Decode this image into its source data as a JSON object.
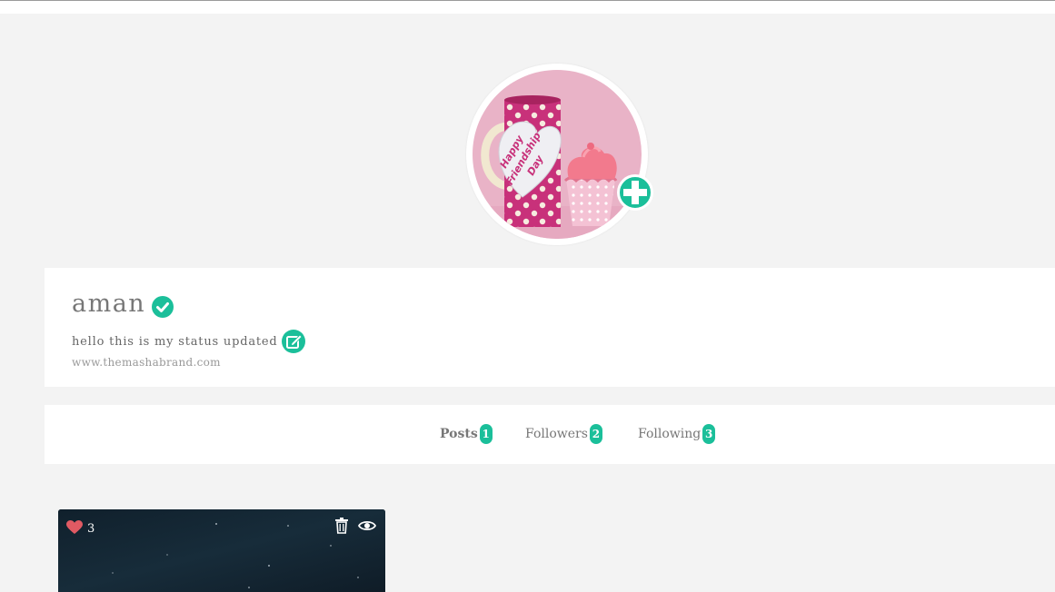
{
  "profile": {
    "username": "aman",
    "status": "hello this is my status updated",
    "website": "www.themashabrand.com",
    "avatar": {
      "mug_text_line1": "Happy",
      "mug_text_line2": "Friendship",
      "mug_text_line3": "Day"
    }
  },
  "tabs": [
    {
      "label": "Posts",
      "count": "1",
      "active": true
    },
    {
      "label": "Followers",
      "count": "2",
      "active": false
    },
    {
      "label": "Following",
      "count": "3",
      "active": false
    }
  ],
  "posts": [
    {
      "likes": "3"
    }
  ],
  "colors": {
    "accent": "#1bbf9a",
    "background": "#f3f3f3",
    "like": "#e05a63"
  },
  "icons": {
    "verified": "check-circle-icon",
    "edit": "edit-icon",
    "add_photo": "plus-icon",
    "like": "heart-icon",
    "delete": "trash-icon",
    "view": "eye-icon"
  }
}
